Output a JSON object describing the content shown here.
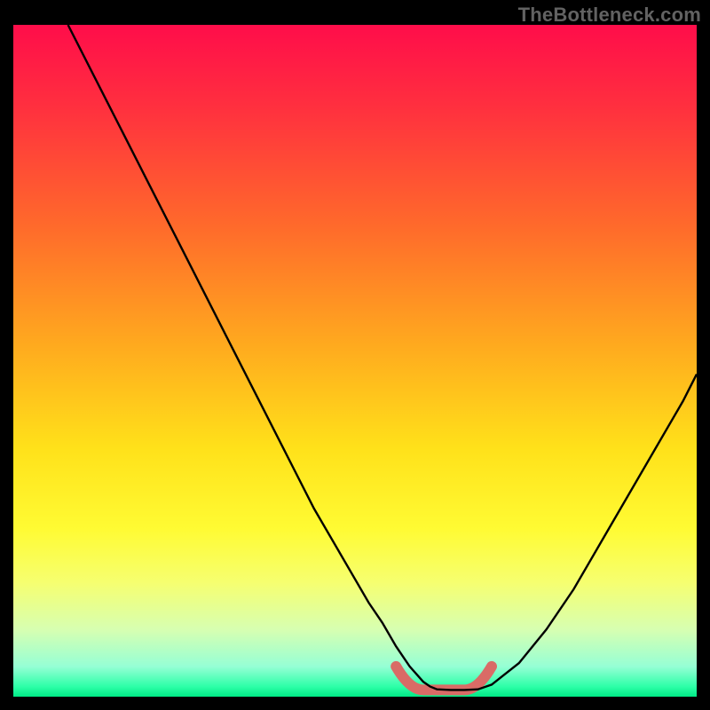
{
  "watermark": "TheBottleneck.com",
  "colors": {
    "frame": "#000000",
    "curve": "#000000",
    "trough": "#d96b66",
    "gradient_stops": [
      {
        "offset": 0.0,
        "color": "#ff0d4a"
      },
      {
        "offset": 0.12,
        "color": "#ff2f3f"
      },
      {
        "offset": 0.3,
        "color": "#ff6a2b"
      },
      {
        "offset": 0.48,
        "color": "#ffab1e"
      },
      {
        "offset": 0.63,
        "color": "#ffe11a"
      },
      {
        "offset": 0.75,
        "color": "#fffb33"
      },
      {
        "offset": 0.83,
        "color": "#f6ff70"
      },
      {
        "offset": 0.9,
        "color": "#d7ffb1"
      },
      {
        "offset": 0.955,
        "color": "#96ffd5"
      },
      {
        "offset": 0.985,
        "color": "#2dffa8"
      },
      {
        "offset": 1.0,
        "color": "#00e985"
      }
    ]
  },
  "chart_data": {
    "type": "line",
    "title": "",
    "xlabel": "",
    "ylabel": "",
    "xlim": [
      0,
      100
    ],
    "ylim": [
      0,
      100
    ],
    "x": [
      8,
      12,
      16,
      20,
      24,
      28,
      32,
      36,
      40,
      44,
      48,
      52,
      54,
      56,
      58,
      60,
      61,
      62,
      64,
      66,
      68,
      70,
      74,
      78,
      82,
      86,
      90,
      94,
      98,
      100
    ],
    "values": [
      100,
      92,
      84,
      76,
      68,
      60,
      52,
      44,
      36,
      28,
      21,
      14,
      11,
      7.5,
      4.5,
      2.2,
      1.5,
      1.1,
      1.0,
      1.0,
      1.1,
      1.8,
      5,
      10,
      16,
      23,
      30,
      37,
      44,
      48
    ],
    "trough_range_x": [
      56,
      70
    ],
    "trough_value": 1.0
  }
}
